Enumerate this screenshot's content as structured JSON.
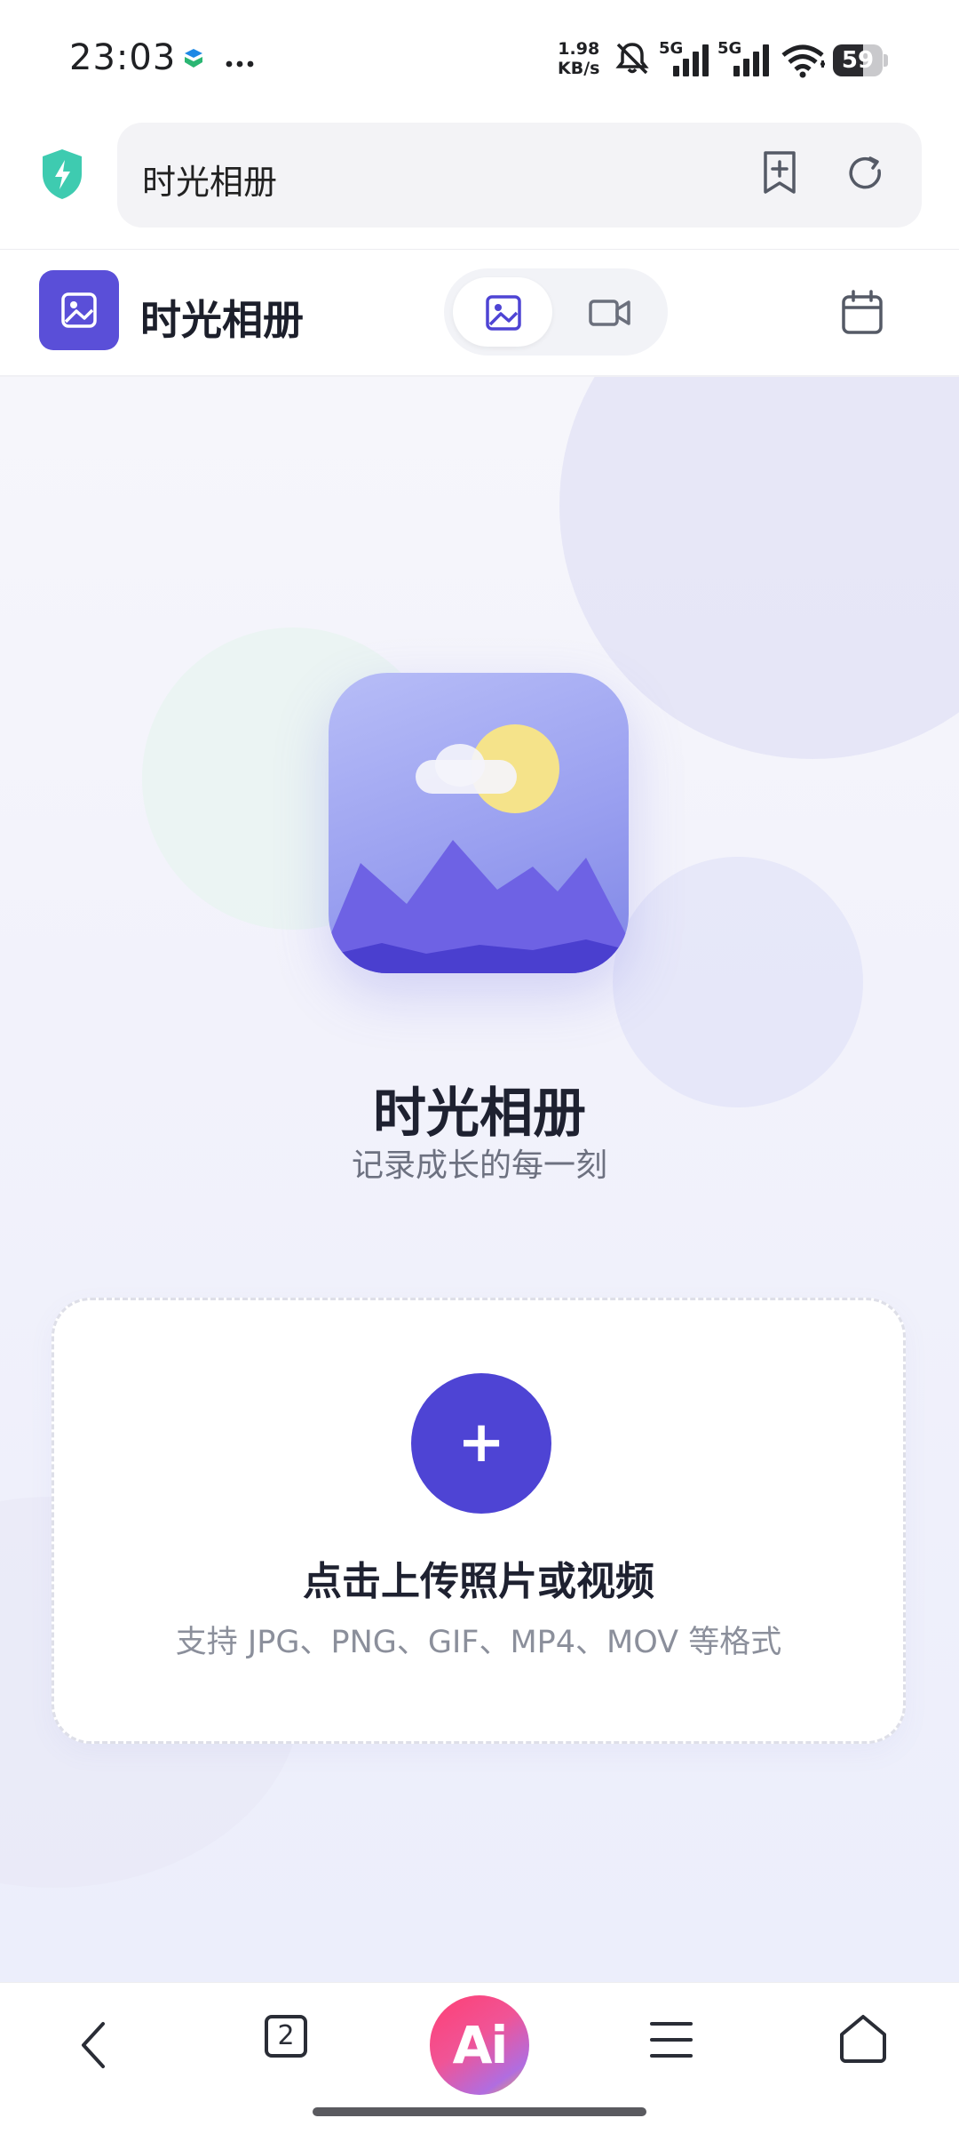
{
  "status_bar": {
    "time": "23:03",
    "net_speed_value": "1.98",
    "net_speed_unit": "KB/s",
    "signal_1_label": "5G",
    "signal_2_label": "5G",
    "battery": "59",
    "icons": [
      "app-notification-icon",
      "more-dots-icon",
      "mute-icon",
      "signal-icon",
      "wifi-icon",
      "battery-icon"
    ]
  },
  "browser": {
    "address_text": "时光相册",
    "icons": [
      "security-shield-icon",
      "add-bookmark-icon",
      "refresh-icon"
    ]
  },
  "app_header": {
    "title": "时光相册",
    "tabs": [
      {
        "name": "photos",
        "icon": "image-icon",
        "active": true
      },
      {
        "name": "videos",
        "icon": "video-icon",
        "active": false
      }
    ],
    "calendar_icon": "calendar-icon"
  },
  "hero": {
    "title": "时光相册",
    "subtitle": "记录成长的每一刻"
  },
  "upload": {
    "button_symbol": "+",
    "title": "点击上传照片或视频",
    "hint": "支持 JPG、PNG、GIF、MP4、MOV 等格式"
  },
  "bottom_nav": {
    "tab_count": "2",
    "ai_label": "Ai",
    "icons": [
      "back-icon",
      "tabs-icon",
      "ai-assistant-icon",
      "menu-icon",
      "home-icon"
    ]
  },
  "colors": {
    "accent": "#4e44d4",
    "app_logo": "#5a4fd8",
    "shield": "#3ecbb0",
    "text_primary": "#1e2130",
    "text_secondary": "#6d7180"
  }
}
